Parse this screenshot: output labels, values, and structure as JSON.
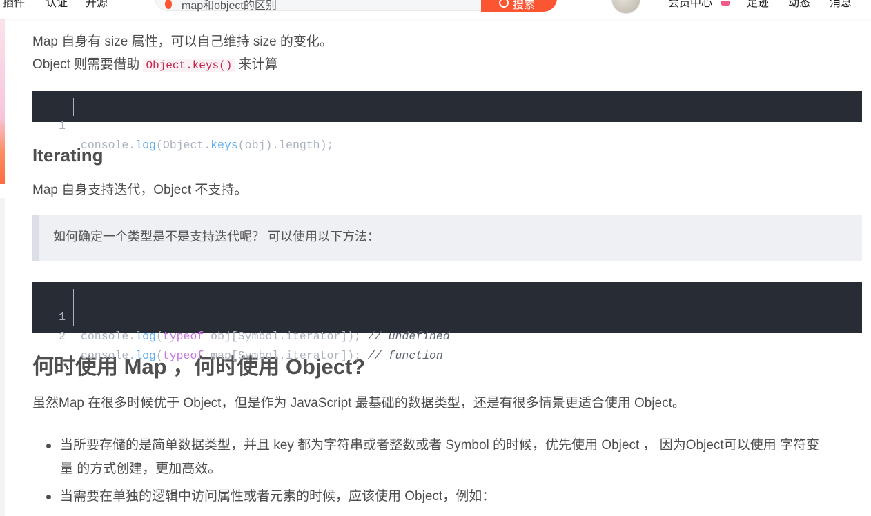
{
  "nav": {
    "items": [
      "插件",
      "认证",
      "开源"
    ],
    "search_query": "map和object的区别",
    "search_button": "搜索",
    "right_items": [
      "会员中心",
      "足迹",
      "动态",
      "消息"
    ]
  },
  "article": {
    "size_para_1": "Map 自身有 size 属性，可以自己维持 size 的变化。",
    "size_para_2_pre": "Object 则需要借助 ",
    "size_para_2_code": "Object.keys()",
    "size_para_2_post": " 来计算",
    "code1": {
      "line_no": "1",
      "t1": "console.",
      "t2": "log",
      "t3": "(Object.",
      "t4": "keys",
      "t5": "(obj).length);"
    },
    "heading_iterating": "Iterating",
    "iterating_para": "Map 自身支持迭代，Object 不支持。",
    "quote": "如何确定一个类型是不是支持迭代呢？ 可以使用以下方法：",
    "code2": [
      {
        "line_no": "1",
        "t1": "console.",
        "t2": "log",
        "t3": "(",
        "t4": "typeof",
        "t5": " obj[Symbol.iterator]); ",
        "comment": "// undefined"
      },
      {
        "line_no": "2",
        "t1": "console.",
        "t2": "log",
        "t3": "(",
        "t4": "typeof",
        "t5": " map[Symbol.iterator]); ",
        "comment": "// function"
      }
    ],
    "heading_when": "何时使用 Map ，何时使用 Object?",
    "when_para": "虽然Map 在很多时候优于 Object，但是作为 JavaScript 最基础的数据类型，还是有很多情景更适合使用 Object。",
    "list": [
      {
        "line1": "当所要存储的是简单数据类型，并且 key 都为字符串或者整数或者 Symbol 的时候，优先使用 Object ， 因为Object可以使用 字符变",
        "line2": "量 的方式创建，更加高效。"
      },
      {
        "line1": "当需要在单独的逻辑中访问属性或者元素的时候，应该使用 Object，例如："
      }
    ]
  },
  "colors": {
    "accent": "#fc5531",
    "code_bg": "#282c34",
    "code_fn": "#61afef",
    "code_kw": "#c678dd",
    "code_comment": "#5c6370"
  }
}
